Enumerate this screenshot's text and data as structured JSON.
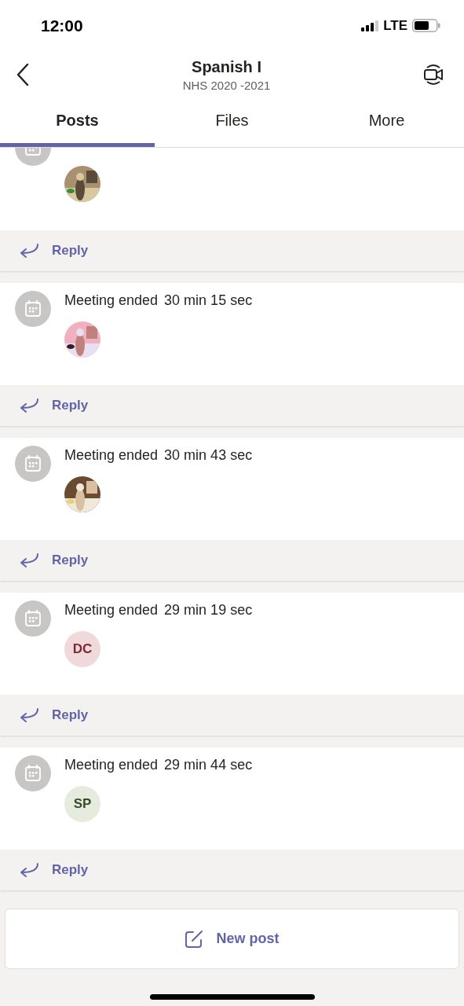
{
  "status_bar": {
    "time": "12:00",
    "network": "LTE"
  },
  "header": {
    "title": "Spanish I",
    "subtitle": "NHS 2020 -2021"
  },
  "tabs": [
    {
      "label": "Posts",
      "selected": true
    },
    {
      "label": "Files",
      "selected": false
    },
    {
      "label": "More",
      "selected": false
    }
  ],
  "posts": [
    {
      "reply": "Reply"
    },
    {
      "title": "Meeting ended",
      "duration": "30 min 15 sec",
      "reply": "Reply"
    },
    {
      "title": "Meeting ended",
      "duration": "30 min 43 sec",
      "reply": "Reply"
    },
    {
      "title": "Meeting ended",
      "duration": "29 min 19 sec",
      "avatar": {
        "kind": "initials",
        "text": "DC",
        "color": "#f1d9db"
      },
      "reply": "Reply"
    },
    {
      "title": "Meeting ended",
      "duration": "29 min 44 sec",
      "avatar": {
        "kind": "initials",
        "text": "SP",
        "color": "#e5ecdd"
      },
      "reply": "Reply"
    }
  ],
  "new_post": "New post"
}
